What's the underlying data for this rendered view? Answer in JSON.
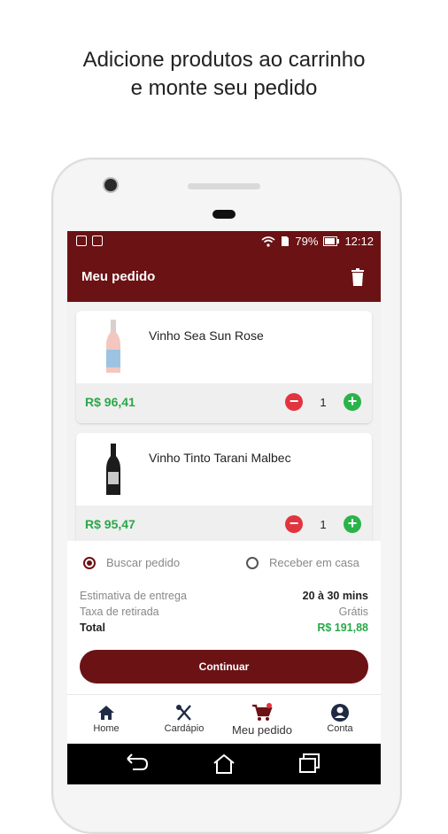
{
  "caption": {
    "line1": "Adicione produtos ao carrinho",
    "line2": "e monte seu pedido"
  },
  "status_bar": {
    "battery": "79%",
    "time": "12:12"
  },
  "app_bar": {
    "title": "Meu pedido",
    "action_icon": "trash-icon"
  },
  "cart": {
    "items": [
      {
        "name": "Vinho Sea Sun Rose",
        "price": "R$ 96,41",
        "quantity": "1"
      },
      {
        "name": "Vinho Tinto Tarani Malbec",
        "price": "R$ 95,47",
        "quantity": "1"
      }
    ]
  },
  "delivery_options": {
    "pickup": "Buscar pedido",
    "home": "Receber em casa",
    "selected": "pickup"
  },
  "summary": {
    "estimate_label": "Estimativa de entrega",
    "estimate_value": "20 à 30 mins",
    "fee_label": "Taxa de retirada",
    "fee_value": "Grátis",
    "total_label": "Total",
    "total_value": "R$ 191,88"
  },
  "continue_label": "Continuar",
  "bottom_nav": {
    "items": [
      {
        "label": "Home",
        "icon": "home-icon"
      },
      {
        "label": "Cardápio",
        "icon": "cutlery-icon"
      },
      {
        "label": "Meu pedido",
        "icon": "cart-icon"
      },
      {
        "label": "Conta",
        "icon": "account-icon"
      }
    ],
    "active": "Meu pedido"
  },
  "colors": {
    "brand": "#6b1215",
    "price_green": "#2aa84a",
    "minus_red": "#e2343f",
    "plus_green": "#2bb34a"
  }
}
